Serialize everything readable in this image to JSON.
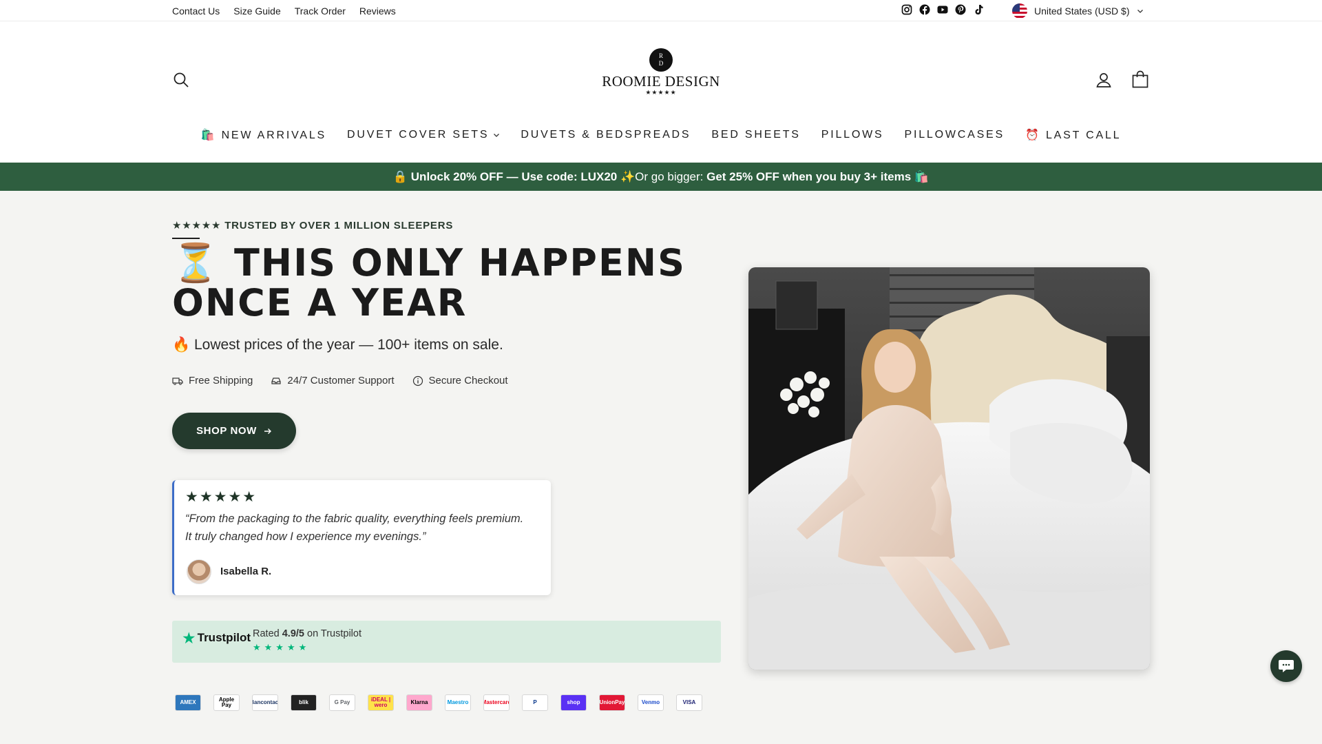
{
  "utility": {
    "links": [
      "Contact Us",
      "Size Guide",
      "Track Order",
      "Reviews"
    ],
    "social_icons": [
      "instagram-icon",
      "facebook-icon",
      "youtube-icon",
      "pinterest-icon",
      "tiktok-icon"
    ],
    "currency": "United States (USD $)"
  },
  "header": {
    "logo_initials_top": "R",
    "logo_initials_bottom": "D",
    "logo_name": "ROOMIE DESIGN",
    "logo_stars": "★★★★★"
  },
  "nav": {
    "items": [
      "🛍️ NEW ARRIVALS",
      "DUVET COVER SETS",
      "DUVETS & BEDSPREADS",
      "BED SHEETS",
      "PILLOWS",
      "PILLOWCASES",
      "⏰ LAST CALL"
    ]
  },
  "promo": {
    "part1": "🔒 Unlock 20% OFF — Use code: LUX20 ✨",
    "part2": "Or go bigger: ",
    "part3": "Get 25% OFF when you buy 3+ items 🛍️"
  },
  "hero": {
    "trusted": "★★★★★ TRUSTED BY OVER 1 MILLION SLEEPERS",
    "headline": "⏳ THIS ONLY HAPPENS ONCE A YEAR",
    "subline": "🔥 Lowest prices of the year — 100+ items on sale.",
    "features": [
      "Free Shipping",
      "24/7 Customer Support",
      "Secure Checkout"
    ],
    "button": "SHOP NOW"
  },
  "review": {
    "stars": "★★★★★",
    "quote": "“From the packaging to the fabric quality, everything feels premium. It truly changed how I experience my evenings.”",
    "author": "Isabella R."
  },
  "trustpilot": {
    "brand": "Trustpilot",
    "rated_prefix": "Rated ",
    "rating": "4.9/5",
    "rated_suffix": " on Trustpilot",
    "stars": "★★★★★"
  },
  "payments": [
    {
      "label": "AMEX",
      "bg": "#2e77bc",
      "fg": "#ffffff"
    },
    {
      "label": "Apple Pay",
      "bg": "#ffffff",
      "fg": "#000000"
    },
    {
      "label": "Bancontact",
      "bg": "#ffffff",
      "fg": "#1e3764"
    },
    {
      "label": "blik",
      "bg": "#222222",
      "fg": "#ffffff"
    },
    {
      "label": "G Pay",
      "bg": "#ffffff",
      "fg": "#5f6368"
    },
    {
      "label": "iDEAL | wero",
      "bg": "#ffe24a",
      "fg": "#cc0066"
    },
    {
      "label": "Klarna",
      "bg": "#ffa8cd",
      "fg": "#000000"
    },
    {
      "label": "Maestro",
      "bg": "#ffffff",
      "fg": "#0099df"
    },
    {
      "label": "Mastercard",
      "bg": "#ffffff",
      "fg": "#eb001b"
    },
    {
      "label": "P",
      "bg": "#ffffff",
      "fg": "#003087"
    },
    {
      "label": "shop",
      "bg": "#5a31f4",
      "fg": "#ffffff"
    },
    {
      "label": "UnionPay",
      "bg": "#e21836",
      "fg": "#ffffff"
    },
    {
      "label": "Venmo",
      "bg": "#ffffff",
      "fg": "#1a4acb"
    },
    {
      "label": "VISA",
      "bg": "#ffffff",
      "fg": "#1a1f71"
    }
  ],
  "colors": {
    "promo_bg": "#2e5e3f",
    "button_bg": "#243a2d",
    "hero_bg": "#f4f4f2",
    "trustpilot_green": "#00b67a"
  }
}
